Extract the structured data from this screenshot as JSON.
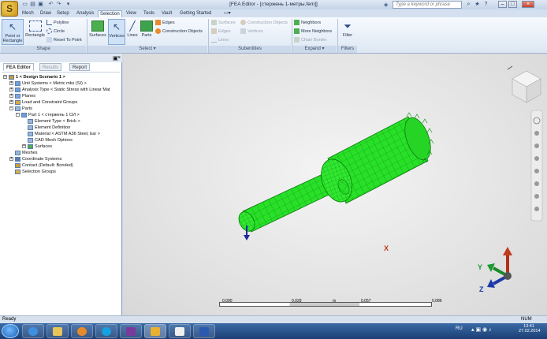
{
  "window": {
    "title": "[FEA Editor - [стержень 1-метры.fem]]",
    "search_placeholder": "Type a keyword or phrase",
    "logo_letter": "S"
  },
  "menu": {
    "tabs": [
      "Mesh",
      "Draw",
      "Setup",
      "Analysis",
      "Selection",
      "View",
      "Tools",
      "Vault",
      "Getting Started"
    ],
    "active": "Selection"
  },
  "ribbon": {
    "shape": {
      "label": "Shape",
      "point_or_rectangle": "Point or Rectangle",
      "rectangle": "Rectangle",
      "polyline": "Polyline",
      "circle": "Circle",
      "reset_to_point": "Reset To Point"
    },
    "select": {
      "label": "Select",
      "surfaces": "Surfaces",
      "vertices": "Vertices",
      "lines": "Lines",
      "parts": "Parts",
      "edges": "Edges",
      "construction_objects": "Construction Objects"
    },
    "subentities": {
      "label": "Subentities",
      "surfaces": "Surfaces",
      "edges": "Edges",
      "lines": "Lines",
      "construction_objects": "Construction Objects",
      "vertices": "Vertices"
    },
    "expand": {
      "label": "Expand",
      "neighbors": "Neighbors",
      "more_neighbors": "More Neighbors",
      "chain_border": "Chain Border"
    },
    "filters": {
      "label": "Filters",
      "filter": "Filter"
    }
  },
  "panel": {
    "tabs": [
      "FEA Editor",
      "Results",
      "Report"
    ],
    "tree": [
      {
        "label": "1 < Design Scenario 1 >",
        "level": 0,
        "bold": true
      },
      {
        "label": "Unit Systems < Metric mks (SI) >",
        "level": 1
      },
      {
        "label": "Analysis Type < Static Stress with Linear Mat",
        "level": 1
      },
      {
        "label": "Planes",
        "level": 1
      },
      {
        "label": "Load and Constraint Groups",
        "level": 1
      },
      {
        "label": "Parts",
        "level": 1
      },
      {
        "label": "Part 1 < стержень 1 СИ >",
        "level": 2
      },
      {
        "label": "Element Type < Brick >",
        "level": 3
      },
      {
        "label": "Element Definition",
        "level": 3
      },
      {
        "label": "Material < ASTM A36 Steel, bar >",
        "level": 3
      },
      {
        "label": "CAD Mesh Options",
        "level": 3
      },
      {
        "label": "Surfaces",
        "level": 3
      },
      {
        "label": "Meshes",
        "level": 1
      },
      {
        "label": "Coordinate Systems",
        "level": 1
      },
      {
        "label": "Contact (Default: Bonded)",
        "level": 1
      },
      {
        "label": "Selection Groups",
        "level": 1
      }
    ]
  },
  "viewport": {
    "scale": [
      "0,000",
      "0,029",
      "m",
      "0,057",
      "0,086"
    ],
    "axes": {
      "x": "X",
      "y": "Y",
      "z": "Z"
    },
    "mesh_color": "#22dd22"
  },
  "status": {
    "left": "Ready",
    "right": "NUM"
  },
  "taskbar": {
    "lang": "RU",
    "time": "13:41",
    "date": "27.02.2014"
  }
}
